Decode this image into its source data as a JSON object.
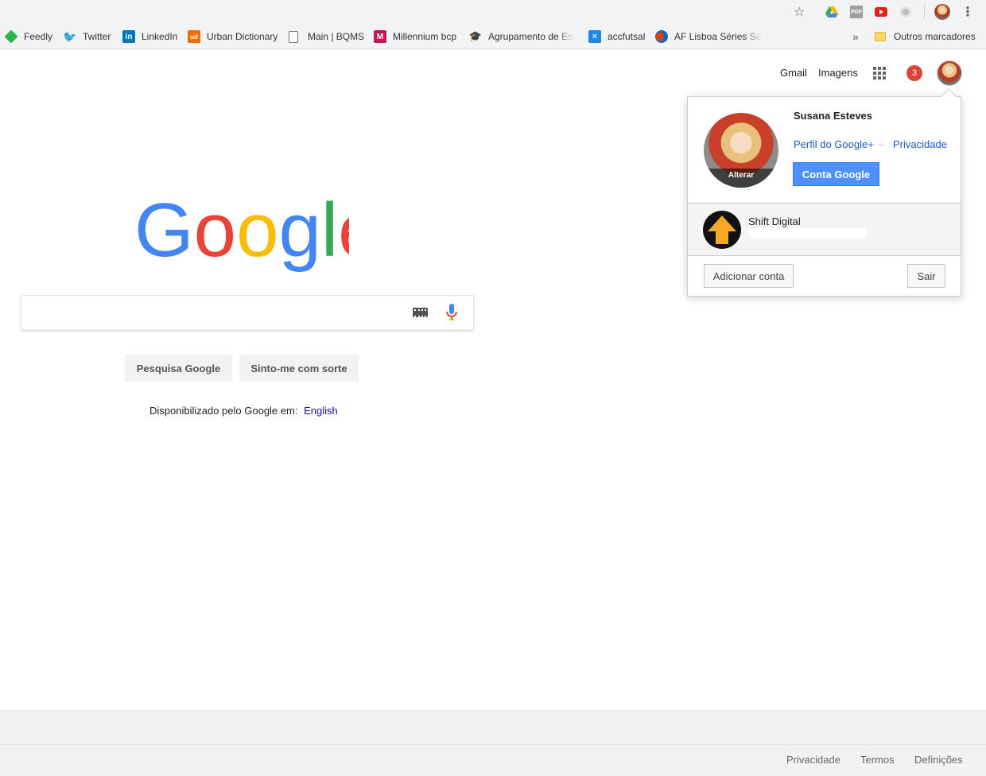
{
  "toolbar": {
    "icons": [
      "star-icon",
      "google-drive-icon",
      "pdf-icon",
      "youtube-icon",
      "extension-icon",
      "profile-icon",
      "menu-icon"
    ]
  },
  "bookmarks": {
    "items": [
      {
        "label": "Feedly",
        "icon": "feedly-icon",
        "color": "#2bb24c"
      },
      {
        "label": "Twitter",
        "icon": "twitter-icon",
        "color": "#1da1f2"
      },
      {
        "label": "LinkedIn",
        "icon": "linkedin-icon",
        "color": "#0077b5"
      },
      {
        "label": "Urban Dictionary",
        "icon": "urban-dictionary-icon",
        "color": "#ef6c00"
      },
      {
        "label": "Main | BQMS",
        "icon": "page-icon",
        "color": "#777777"
      },
      {
        "label": "Millennium bcp",
        "icon": "millennium-icon",
        "color": "#c2185b"
      },
      {
        "label": "Agrupamento de Esc",
        "icon": "graduation-cap-icon",
        "color": "#f4c20d"
      },
      {
        "label": "accfutsal",
        "icon": "accfutsal-icon",
        "color": "#1e88e5"
      },
      {
        "label": "AF Lisboa Séries Sér",
        "icon": "af-lisboa-icon",
        "color": "#1565c0"
      }
    ],
    "overflow": "»",
    "other": "Outros marcadores"
  },
  "header": {
    "gmail": "Gmail",
    "images": "Imagens",
    "notifications": "3"
  },
  "account_popup": {
    "name": "Susana Esteves",
    "change_photo": "Alterar",
    "profile_link": "Perfil do Google+",
    "separator": "–",
    "privacy_link": "Privacidade",
    "account_button": "Conta Google",
    "other_account_name": "Shift Digital",
    "add_account": "Adicionar conta",
    "sign_out": "Sair"
  },
  "logo": {
    "text": "Google",
    "colors": [
      "#4285f4",
      "#ea4335",
      "#fbbc05",
      "#4285f4",
      "#34a853",
      "#ea4335"
    ]
  },
  "search": {
    "value": "",
    "search_button": "Pesquisa Google",
    "lucky_button": "Sinto-me com sorte",
    "offered_in": "Disponibilizado pelo Google em:",
    "language": "English"
  },
  "footer": {
    "privacy": "Privacidade",
    "terms": "Termos",
    "settings": "Definições"
  }
}
